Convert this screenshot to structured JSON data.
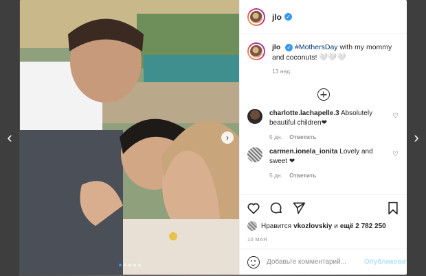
{
  "post": {
    "username": "jlo",
    "verified_mark": "✓",
    "caption": {
      "username": "jlo",
      "hashtag": "#MothersDay",
      "text": " with my mommy and coconuts! 🤍🤍🤍",
      "time": "13 нед."
    },
    "comments": [
      {
        "username": "charlotte.lachapelle.3",
        "text": " Absolutely beautiful children❤",
        "time": "5 дн.",
        "reply_label": "Ответить"
      },
      {
        "username": "carmen.ionela_ionita",
        "text": " Lovely and sweet ❤",
        "time": "5 дн.",
        "reply_label": "Ответить"
      }
    ],
    "likes": {
      "prefix": "Нравится",
      "user": "vkozlovskiy",
      "connector": "и",
      "others": "ещё 2 782 250"
    },
    "date": "10 МАЯ",
    "add_comment": {
      "placeholder": "Добавьте комментарий...",
      "publish_label": "Опубликовать"
    }
  },
  "navigation": {
    "prev_icon": "‹",
    "next_icon": "›",
    "media_next_icon": "›"
  },
  "carousel": {
    "total": 5,
    "active_index": 0
  },
  "icons": [
    "heart-icon",
    "comment-icon",
    "share-icon",
    "bookmark-icon",
    "emoji-icon",
    "plus-circle-icon",
    "verified-icon",
    "chevron-left-icon",
    "chevron-right-icon"
  ],
  "colors": {
    "accent": "#3897f0",
    "publish_disabled": "#b2dffc",
    "text": "#262626",
    "muted": "#8e8e8e"
  }
}
